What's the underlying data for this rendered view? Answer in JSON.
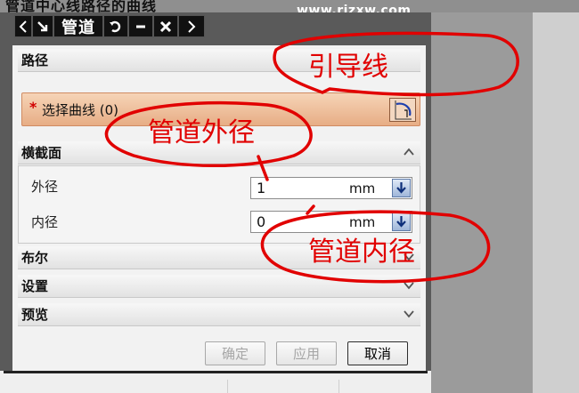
{
  "window": {
    "title_fragment": "管道中心线路径的曲线"
  },
  "watermark": "www.rjzxw.com",
  "dialog": {
    "title": "管道",
    "sections": {
      "path": {
        "label": "路径",
        "select_label": "选择曲线 (0)"
      },
      "cross_section": {
        "label": "横截面",
        "outer_label": "外径",
        "outer_value": "1",
        "outer_unit": "mm",
        "inner_label": "内径",
        "inner_value": "0",
        "inner_unit": "mm"
      },
      "boolean": {
        "label": "布尔"
      },
      "settings": {
        "label": "设置"
      },
      "preview": {
        "label": "预览"
      }
    },
    "buttons": {
      "ok": "确定",
      "apply": "应用",
      "cancel": "取消"
    }
  },
  "annotations": {
    "guide_line": "引导线",
    "outer_diameter": "管道外径",
    "inner_diameter": "管道内径"
  },
  "colors": {
    "annotation": "#e10000",
    "selection_row": "#e7ad85",
    "required_star": "#d10000"
  }
}
